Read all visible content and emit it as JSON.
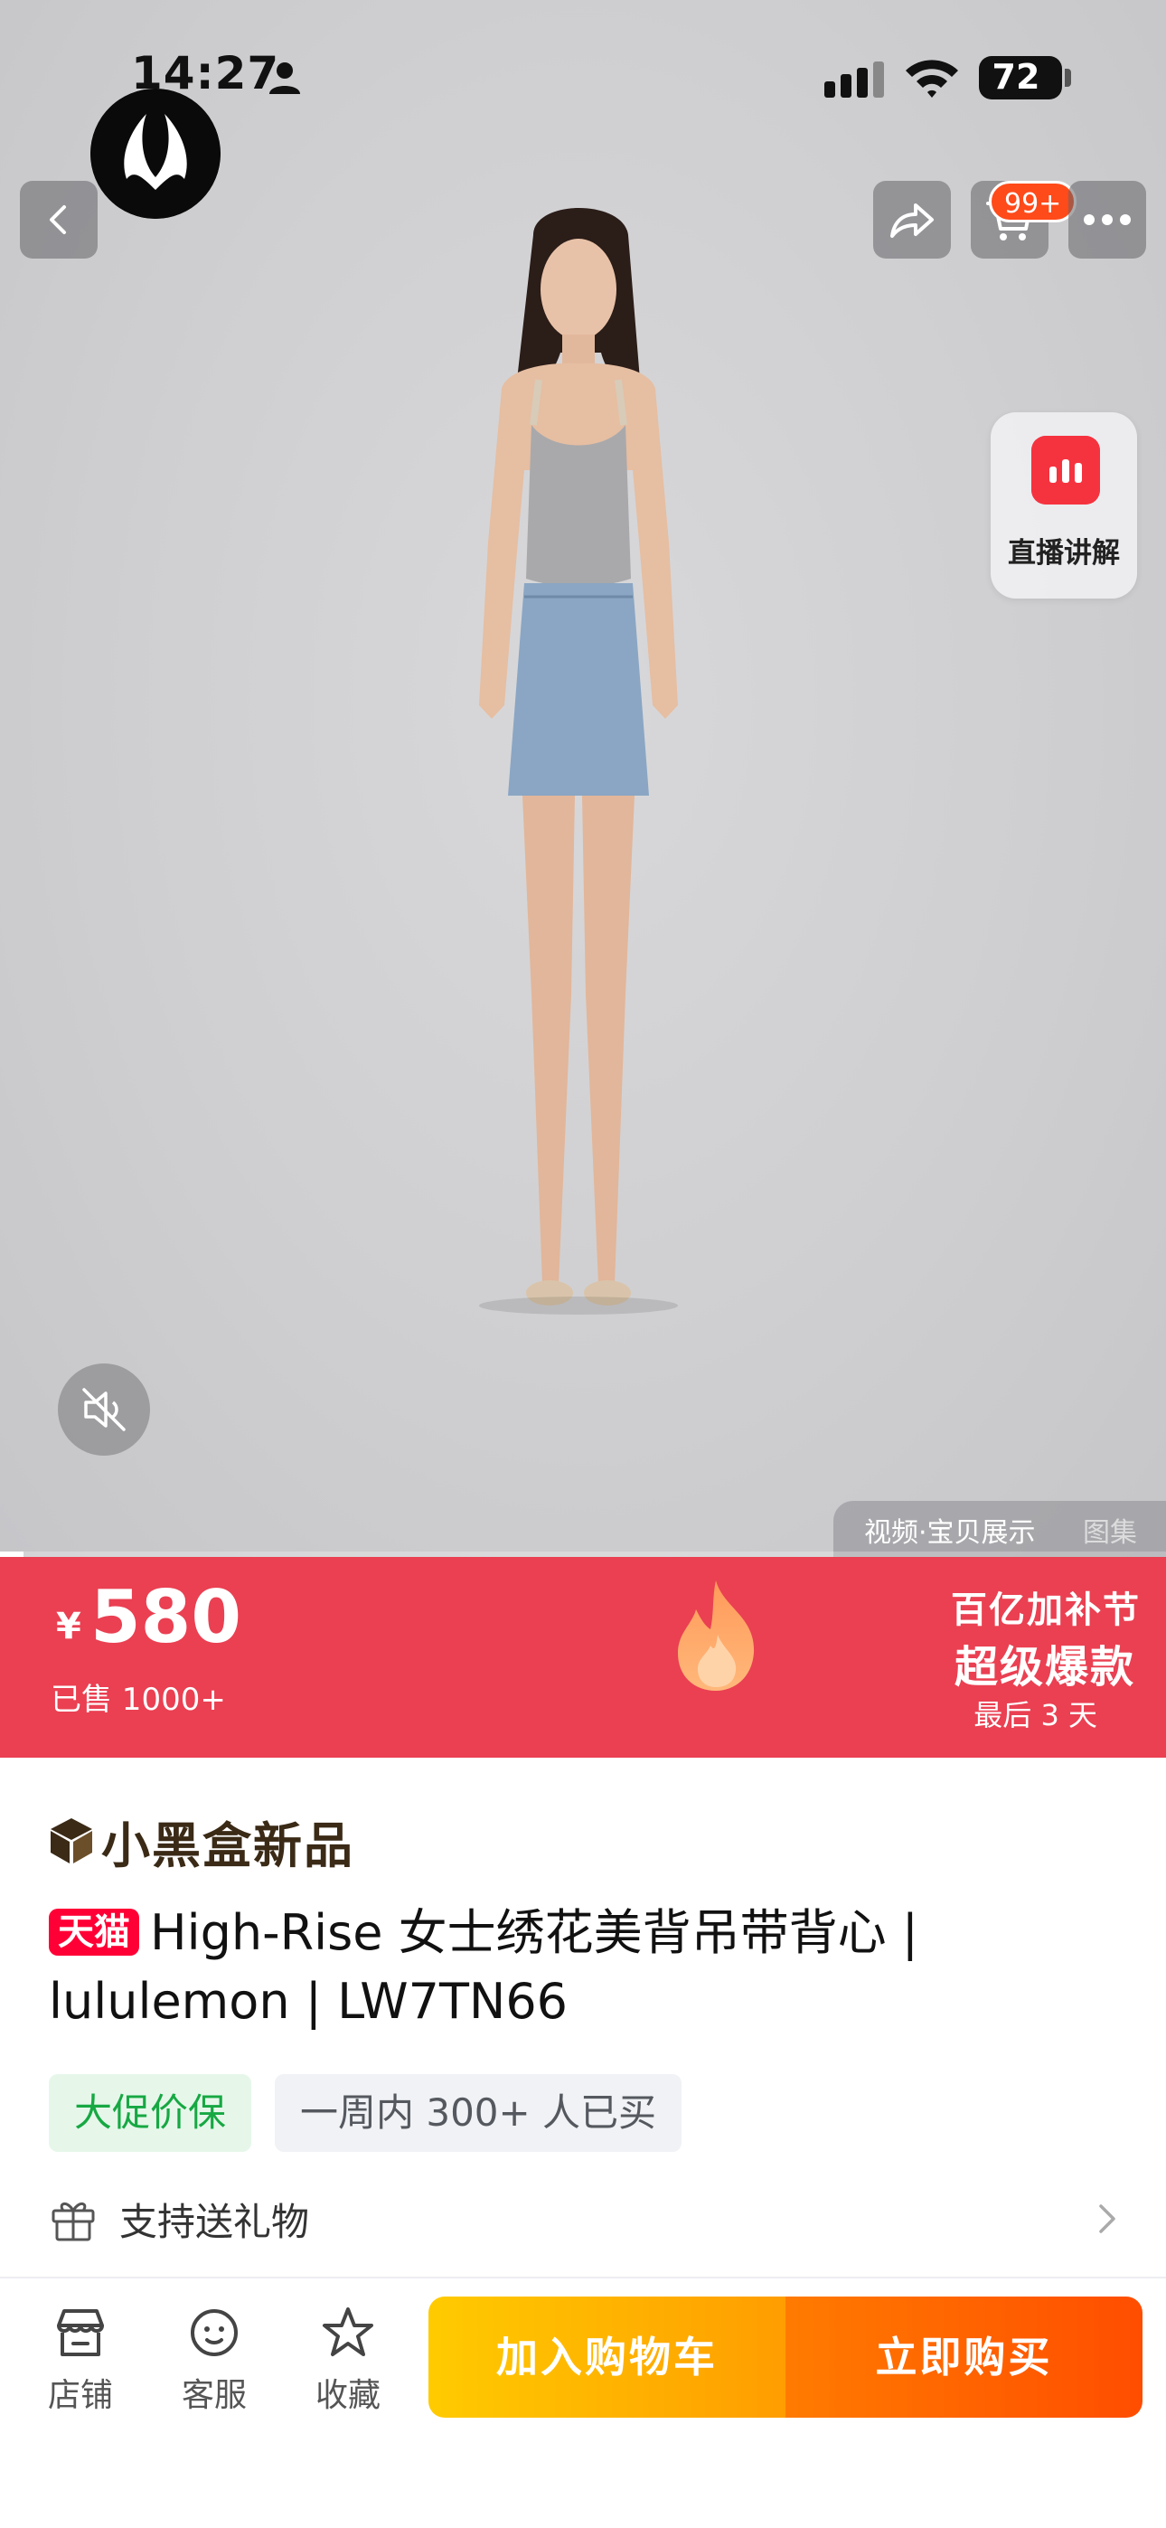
{
  "status_bar": {
    "time": "14:27",
    "battery": "72"
  },
  "media": {
    "tabs": [
      "视频·宝贝展示",
      "图集"
    ],
    "live_label": "直播讲解",
    "cart_badge": "99+",
    "video_progress": 0.02
  },
  "price": {
    "currency_symbol": "¥",
    "value": "580",
    "sold": "已售 1000+",
    "promo_line1": "百亿加补节",
    "promo_line2": "超级爆款",
    "promo_line3": "最后 3 天"
  },
  "product": {
    "new_tag": "小黑盒新品",
    "platform_badge": "天猫",
    "title": "High-Rise 女士绣花美背吊带背心 | lululemon | LW7TN66",
    "chips": [
      "大促价保",
      "一周内 300+ 人已买"
    ],
    "gift_text": "支持送礼物"
  },
  "bottom_bar": {
    "nav": [
      "店铺",
      "客服",
      "收藏"
    ],
    "add_to_cart": "加入购物车",
    "buy_now": "立即购买"
  },
  "colors": {
    "price_banner": "#ea4052",
    "tmall_red": "#ff0036",
    "promo_green": "#17a843",
    "cart_yellow": "#ffb300",
    "buy_orange": "#ff5a00"
  },
  "icons": [
    "person-icon",
    "signal-icon",
    "wifi-icon",
    "battery-icon",
    "back-icon",
    "share-icon",
    "cart-icon",
    "more-icon",
    "live-icon",
    "mute-icon",
    "flame-icon",
    "box-icon",
    "gift-icon",
    "chevron-right-icon",
    "shop-icon",
    "service-icon",
    "star-icon"
  ]
}
